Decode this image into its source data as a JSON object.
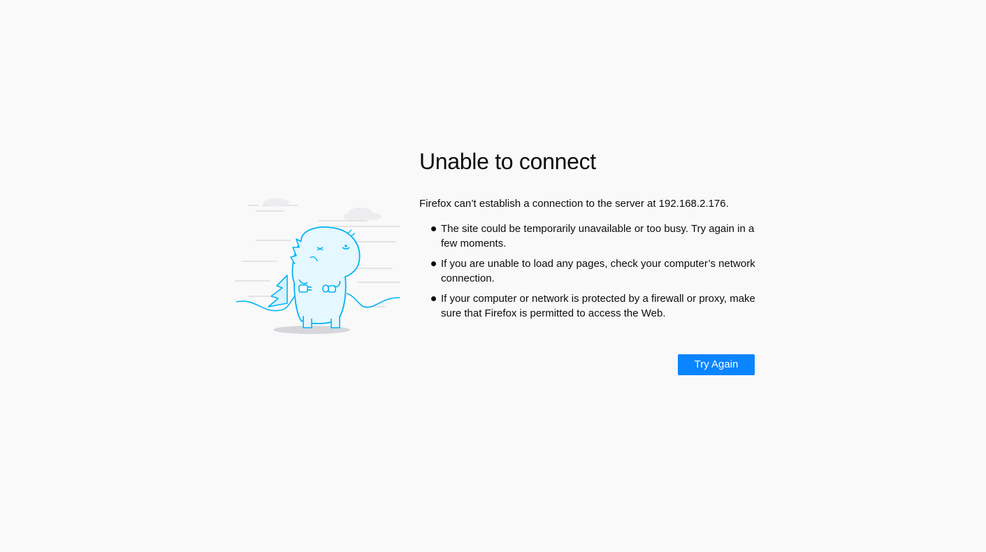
{
  "error": {
    "title": "Unable to connect",
    "message": "Firefox can’t establish a connection to the server at 192.168.2.176.",
    "tips": [
      "The site could be temporarily unavailable or too busy. Try again in a few moments.",
      "If you are unable to load any pages, check your computer’s network connection.",
      "If your computer or network is protected by a firewall or proxy, make sure that Firefox is permitted to access the Web."
    ],
    "illustration": "unplugged-dinosaur-illustration"
  },
  "actions": {
    "try_again_label": "Try Again"
  },
  "colors": {
    "background": "#f9f9fa",
    "accent": "#0a84ff",
    "illustration_line": "#00b3f4",
    "illustration_fill": "#d6f3ff"
  }
}
